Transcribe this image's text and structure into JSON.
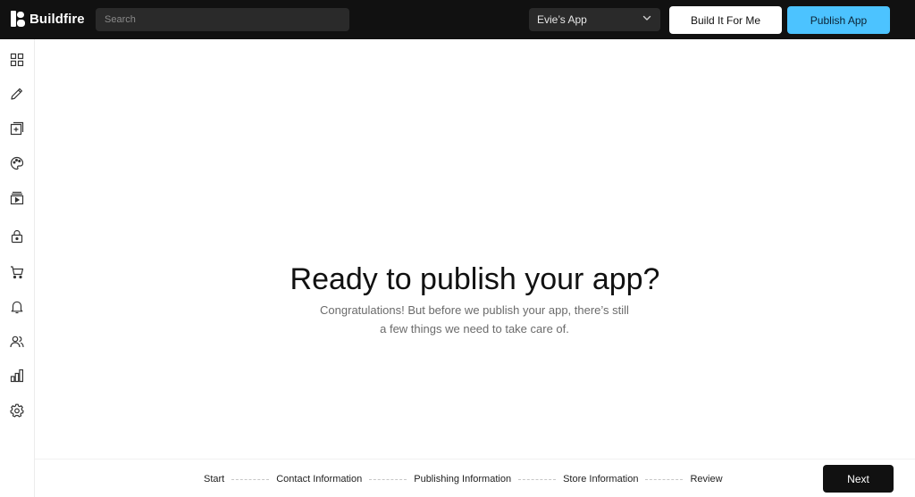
{
  "brand": {
    "name": "Buildfire",
    "icon": "buildfire-logo-icon"
  },
  "search": {
    "placeholder": "Search",
    "value": ""
  },
  "app_selector": {
    "selected": "Evie’s App",
    "icon": "chevron-down-icon"
  },
  "header_buttons": {
    "build_label": "Build It For Me",
    "publish_label": "Publish App"
  },
  "colors": {
    "topbar": "#111111",
    "accent": "#4cc3ff",
    "next_button": "#111111"
  },
  "sidebar": {
    "items": [
      {
        "name": "dashboard",
        "icon": "grid-icon"
      },
      {
        "name": "edit",
        "icon": "pencil-icon"
      },
      {
        "name": "add-feature",
        "icon": "add-square-icon"
      },
      {
        "name": "design",
        "icon": "palette-icon"
      },
      {
        "name": "media",
        "icon": "media-play-icon"
      },
      {
        "name": "security",
        "icon": "lock-icon"
      },
      {
        "name": "ecommerce",
        "icon": "cart-icon"
      },
      {
        "name": "notifications",
        "icon": "bell-icon"
      },
      {
        "name": "users",
        "icon": "users-icon"
      },
      {
        "name": "analytics",
        "icon": "bar-chart-icon"
      },
      {
        "name": "settings",
        "icon": "gear-icon"
      }
    ]
  },
  "hero": {
    "title": "Ready to publish your app?",
    "subtitle_line1": "Congratulations! But before we publish your app, there’s still",
    "subtitle_line2": "a few things we need to take care of."
  },
  "steps": [
    "Start",
    "Contact Information",
    "Publishing Information",
    "Store Information",
    "Review"
  ],
  "footer": {
    "next_label": "Next"
  }
}
